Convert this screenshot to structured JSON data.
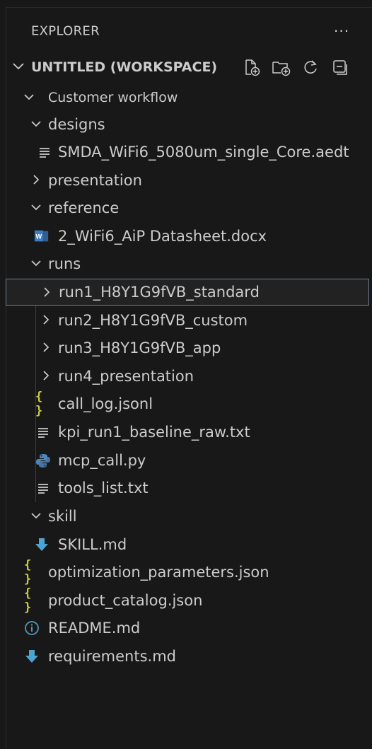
{
  "explorer": {
    "title": "EXPLORER",
    "more_label": "···"
  },
  "workspace": {
    "title": "UNTITLED (WORKSPACE)",
    "actions": [
      "new-file-icon",
      "new-folder-icon",
      "refresh-icon",
      "collapse-all-icon"
    ]
  },
  "tree": [
    {
      "label": "Customer workflow",
      "type": "folder",
      "expanded": true
    },
    {
      "label": "designs",
      "type": "folder",
      "expanded": true
    },
    {
      "label": "SMDA_WiFi6_5080um_single_Core.aedt",
      "type": "file",
      "icon": "text-file-icon"
    },
    {
      "label": "presentation",
      "type": "folder",
      "expanded": false
    },
    {
      "label": "reference",
      "type": "folder",
      "expanded": true
    },
    {
      "label": "2_WiFi6_AiP Datasheet.docx",
      "type": "file",
      "icon": "word-file-icon"
    },
    {
      "label": "runs",
      "type": "folder",
      "expanded": true
    },
    {
      "label": "run1_H8Y1G9fVB_standard",
      "type": "folder",
      "expanded": false,
      "selected": true
    },
    {
      "label": "run2_H8Y1G9fVB_custom",
      "type": "folder",
      "expanded": false
    },
    {
      "label": "run3_H8Y1G9fVB_app",
      "type": "folder",
      "expanded": false
    },
    {
      "label": "run4_presentation",
      "type": "folder",
      "expanded": false
    },
    {
      "label": "call_log.jsonl",
      "type": "file",
      "icon": "json-file-icon"
    },
    {
      "label": "kpi_run1_baseline_raw.txt",
      "type": "file",
      "icon": "text-file-icon"
    },
    {
      "label": "mcp_call.py",
      "type": "file",
      "icon": "python-file-icon"
    },
    {
      "label": "tools_list.txt",
      "type": "file",
      "icon": "text-file-icon"
    },
    {
      "label": "skill",
      "type": "folder",
      "expanded": true
    },
    {
      "label": "SKILL.md",
      "type": "file",
      "icon": "markdown-download-icon"
    },
    {
      "label": "optimization_parameters.json",
      "type": "file",
      "icon": "json-file-icon"
    },
    {
      "label": "product_catalog.json",
      "type": "file",
      "icon": "json-file-icon"
    },
    {
      "label": "README.md",
      "type": "file",
      "icon": "info-file-icon"
    },
    {
      "label": "requirements.md",
      "type": "file",
      "icon": "markdown-download-icon"
    }
  ],
  "colors": {
    "background": "#181818",
    "text": "#cccccc",
    "selection_border": "#6d7f91",
    "json_icon": "#cbcb41",
    "python_icon": "#4d86b8",
    "word_icon": "#3d7dc4",
    "info_icon": "#519aba",
    "markdown_icon": "#4fa3d1"
  }
}
